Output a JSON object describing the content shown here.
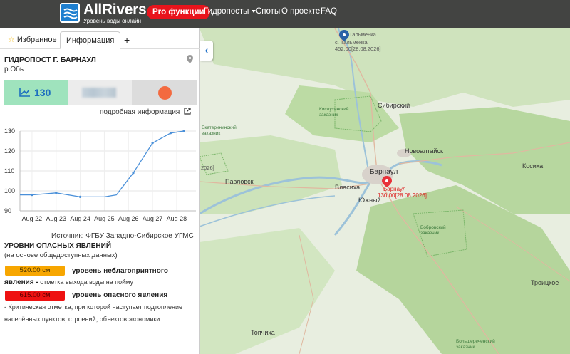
{
  "header": {
    "logo_title": "AllRivers",
    "logo_subtitle": "Уровень воды онлайн",
    "pro_button": "Pro функции",
    "nav": [
      "Гидропосты",
      "Споты",
      "О проекте",
      "FAQ"
    ]
  },
  "tabs": {
    "favorites": "Избранное",
    "info": "Информация",
    "add": "+"
  },
  "station": {
    "title": "ГИДРОПОСТ Г. БАРНАУЛ",
    "river": "р.Обь",
    "current_level": "130",
    "detail_link": "подробная информация",
    "status_color": "#f36a40"
  },
  "chart_data": {
    "type": "line",
    "x": [
      "Aug 21.5",
      "Aug 22",
      "Aug 23",
      "Aug 24",
      "Aug 25",
      "Aug 25.5",
      "Aug 26",
      "Aug 27",
      "Aug 28",
      "Aug 28.3"
    ],
    "categories": [
      "Aug 22",
      "Aug 23",
      "Aug 24",
      "Aug 25",
      "Aug 26",
      "Aug 27",
      "Aug 28"
    ],
    "values": [
      98,
      98,
      99,
      97,
      97,
      98,
      109,
      124,
      129,
      130
    ],
    "ylim": [
      90,
      130
    ],
    "yticks": [
      "130",
      "120",
      "110",
      "100",
      "90"
    ],
    "grid": true,
    "color": "#4a90d9"
  },
  "source": "Источник: ФГБУ Западно-Сибирское УГМС",
  "danger": {
    "title": "УРОВНИ ОПАСНЫХ ЯВЛЕНИЙ",
    "subtitle": "(на основе общедоступных данных)",
    "levels": [
      {
        "value": "520.00 см",
        "name": "уровень неблагоприятного",
        "name_bold_2": "явления -",
        "desc": " отметка выхода воды на пойму",
        "color": "#f7a600"
      },
      {
        "value": "615.00 см",
        "name": "уровень опасного явления",
        "desc_1": "- Критическая отметка, при которой наступает подтопление",
        "desc_2": "населённых пунктов, строений, объектов экономики",
        "color": "#e11111"
      }
    ]
  },
  "map": {
    "labels": {
      "talmenka_name": "с. Тальменка",
      "talmenka_value": "452.00[28.08.2026]",
      "talmenka_top": "Тальменка",
      "barnaul": "Барнаул",
      "barnaul_value": "130.00[28.08.2026]",
      "barnaul_city": "Барнаул",
      "novoaltaysk": "Новоалтайск",
      "sibirsky": "Сибирский",
      "vlasikha": "Власиха",
      "yuzhny": "Южный",
      "pavlovsk": "Павловск",
      "kosikha": "Косиха",
      "troitskoe": "Троицкое",
      "topchikha": "Топчиха",
      "kislukha": "Кислухинский заказник",
      "ekaterin": "Екатерининский заказник",
      "bobrovsky": "Бобровский заказник",
      "bolshereche": "Большереченский заказник",
      "edge_2026": "2026]"
    }
  }
}
